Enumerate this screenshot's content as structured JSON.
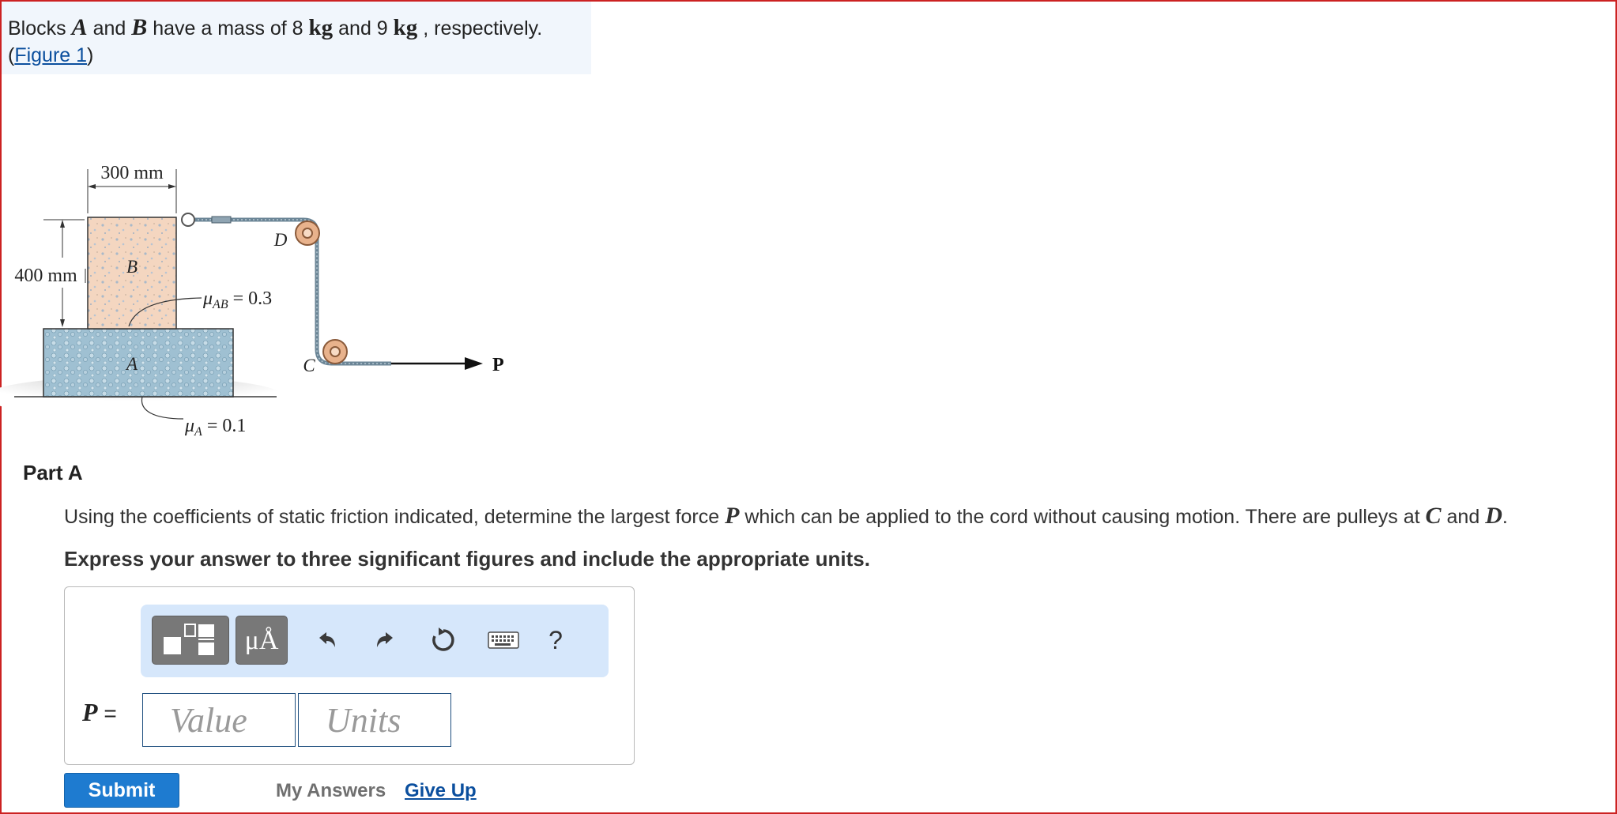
{
  "intro": {
    "line_parts": [
      "Blocks",
      "A",
      "and",
      "B",
      "have a mass of 8",
      "kg",
      "and 9",
      "kg",
      ", respectively."
    ],
    "figure_link_open": "(",
    "figure_link": "Figure 1",
    "figure_link_close": ")"
  },
  "figure": {
    "width_label": "300 mm",
    "height_label": "400 mm",
    "block_b_label": "B",
    "block_a_label": "A",
    "pulley_d_label": "D",
    "pulley_c_label": "C",
    "force_label": "P",
    "mu_ab_symbol": "μ",
    "mu_ab_sub": "AB",
    "mu_ab_value": "= 0.3",
    "mu_a_symbol": "μ",
    "mu_a_sub": "A",
    "mu_a_value": "= 0.1"
  },
  "part": {
    "title": "Part A",
    "question_parts": [
      "Using the coefficients of static friction indicated, determine the largest force",
      "P",
      "which can be applied to the cord without causing motion. There are pulleys at",
      "C",
      "and",
      "D",
      "."
    ],
    "instruction": "Express your answer to three significant figures and include the appropriate units."
  },
  "answer": {
    "variable": "P",
    "equals": "=",
    "value_placeholder": "Value",
    "units_placeholder": "Units",
    "units_button": "μÅ",
    "help": "?"
  },
  "actions": {
    "submit": "Submit",
    "my_answers": "My Answers",
    "give_up": "Give Up"
  },
  "icons": [
    "templates-icon",
    "units-icon",
    "undo-icon",
    "redo-icon",
    "reset-icon",
    "keyboard-icon",
    "help-icon"
  ],
  "colors": {
    "frame_border": "#cc2222",
    "intro_background": "#f1f6fc",
    "toolbar_background": "#d6e7fb",
    "link": "#0b4f9e",
    "submit_button": "#1e7bd0"
  }
}
